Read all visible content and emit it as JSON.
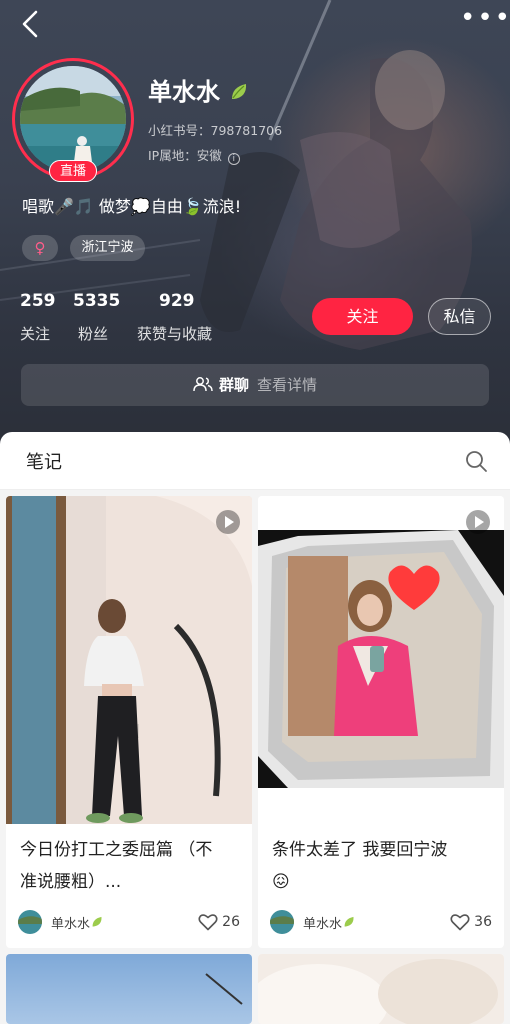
{
  "profile": {
    "username": "单水水",
    "red_id": "小红书号：798781706",
    "ip_location": "IP属地：安徽",
    "bio": "唱歌🎤🎵 做梦💭自由🍃流浪!",
    "live_badge": "直播",
    "gender_symbol": "♀",
    "location_tag": "浙江宁波"
  },
  "stats": [
    {
      "value": "259",
      "label": "关注"
    },
    {
      "value": "5335",
      "label": "粉丝"
    },
    {
      "value": "929",
      "label": "获赞与收藏"
    }
  ],
  "actions": {
    "follow": "关注",
    "message": "私信"
  },
  "group": {
    "label": "群聊",
    "detail": "查看详情"
  },
  "topbar": {
    "more": "•••"
  },
  "tabs": {
    "notes": "笔记"
  },
  "notes": [
    {
      "title_line1": "今日份打工之委屈篇 （不",
      "title_line2": "准说腰粗）...",
      "author": "单水水",
      "likes": "26",
      "is_video": true
    },
    {
      "title_line1": "条件太差了 我要回宁波",
      "title_line2": "😖",
      "author": "单水水",
      "likes": "36",
      "is_video": true
    }
  ],
  "colors": {
    "accent": "#ff2442",
    "header_bg": "#3a4150"
  }
}
